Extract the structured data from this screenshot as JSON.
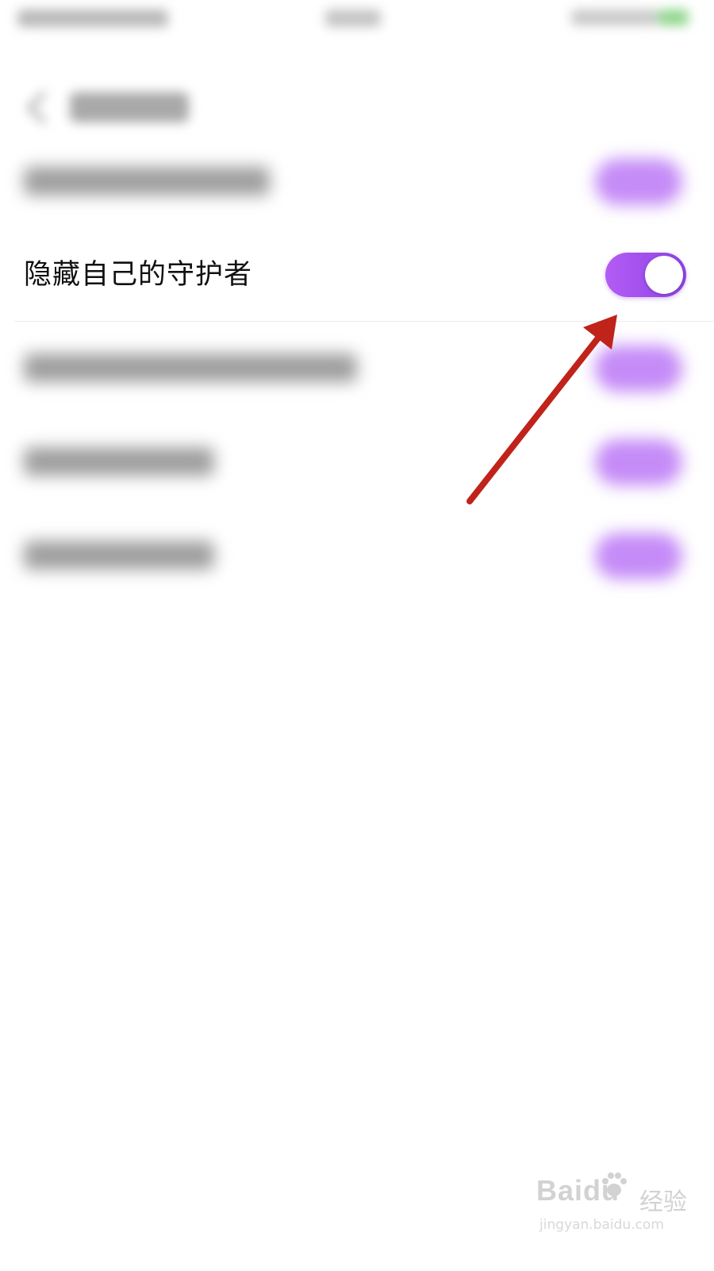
{
  "settings_list": {
    "highlighted_item": {
      "label": "隐藏自己的守护者",
      "toggle_state": "on",
      "toggle_color": "#9b4cf0"
    }
  },
  "colors": {
    "accent": "#9b4cf0",
    "annotation_arrow": "#c0231a"
  },
  "watermark": {
    "logo": "Baidu",
    "logo_cn": "经验",
    "url": "jingyan.baidu.com"
  }
}
